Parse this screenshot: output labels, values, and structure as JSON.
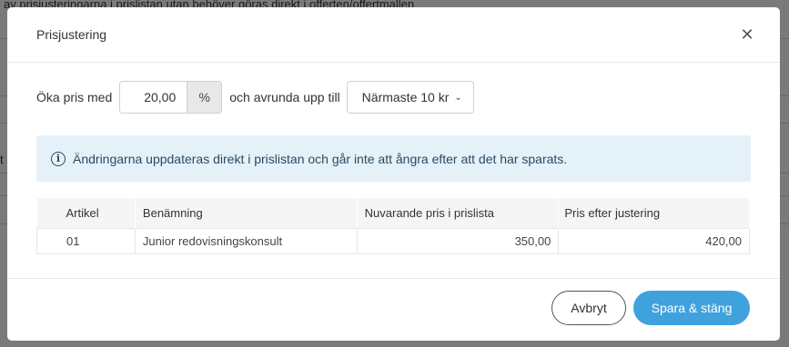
{
  "background": {
    "banner_text": "av prisjusteringarna i prislistan utan behöver göras direkt i offerten/offertmallen",
    "side_letter": "t"
  },
  "modal": {
    "title": "Prisjustering",
    "close_icon": "close-icon",
    "adjust": {
      "increase_label": "Öka pris med",
      "percent_value": "20,00",
      "percent_symbol": "%",
      "round_label": "och avrunda upp till",
      "round_selected": "Närmaste 10 kr"
    },
    "info": {
      "icon": "info-icon",
      "text": "Ändringarna uppdateras direkt i prislistan och går inte att ångra efter att det har sparats."
    },
    "table": {
      "headers": [
        "Artikel",
        "Benämning",
        "Nuvarande pris i prislista",
        "Pris efter justering"
      ],
      "rows": [
        [
          "01",
          "Junior redovisningskonsult",
          "350,00",
          "420,00"
        ]
      ]
    },
    "footer": {
      "cancel_label": "Avbryt",
      "save_label": "Spara & stäng",
      "accent_color": "#3fa2dc"
    }
  }
}
